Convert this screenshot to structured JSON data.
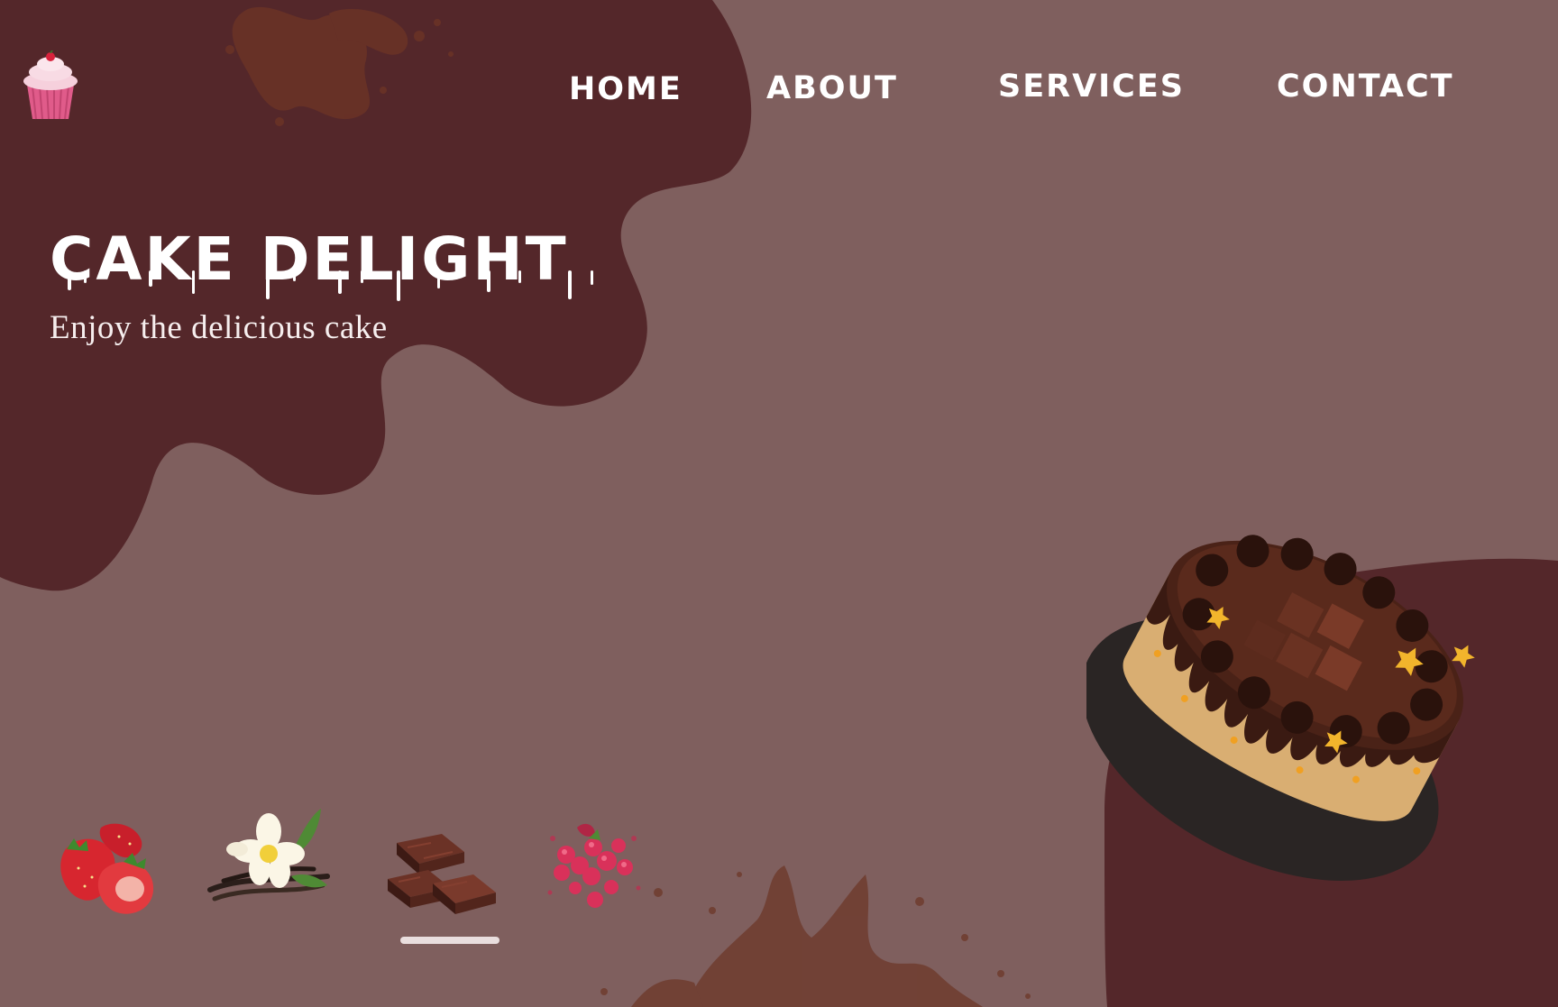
{
  "brand": {
    "logo_icon": "cupcake-icon"
  },
  "nav": {
    "items": [
      {
        "label": "HOME"
      },
      {
        "label": "ABOUT"
      },
      {
        "label": "SERVICES"
      },
      {
        "label": "CONTACT"
      }
    ]
  },
  "hero": {
    "title": "CAKE DELIGHT",
    "subtitle": "Enjoy the delicious cake"
  },
  "flavors": [
    {
      "icon": "strawberry-icon"
    },
    {
      "icon": "vanilla-flower-icon"
    },
    {
      "icon": "chocolate-pieces-icon"
    },
    {
      "icon": "raspberry-icon"
    }
  ],
  "carousel": {
    "active_index": 2
  },
  "colors": {
    "background": "#7f5f5e",
    "blob": "#54272a",
    "text": "#ffffff"
  }
}
